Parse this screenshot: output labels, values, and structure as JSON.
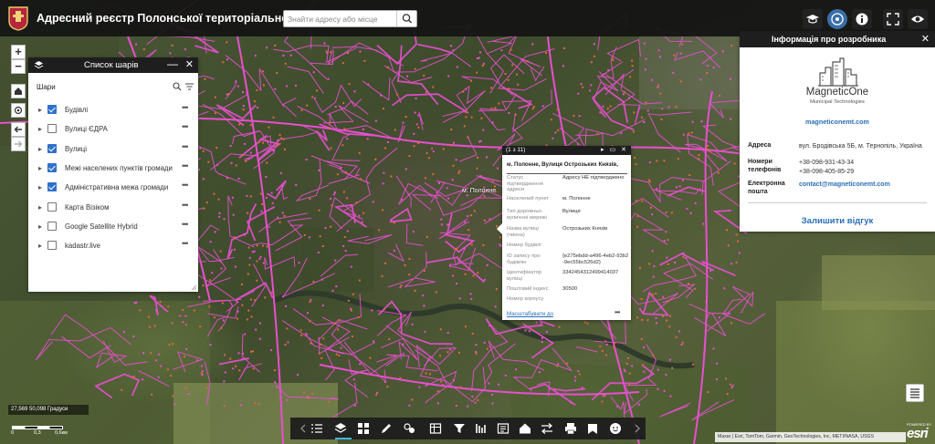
{
  "header": {
    "title": "Адресний реєстр Полонської територіальної громади",
    "search_placeholder": "Знайти адресу або місце"
  },
  "map": {
    "place_label": "м. Полонне",
    "line_color": "#e84fd0",
    "accent": "#2f72c9"
  },
  "zoom": {
    "in": "+",
    "out": "−"
  },
  "layer_list": {
    "title": "Список шарів",
    "section_label": "Шари",
    "minimize": "—",
    "close": "✕",
    "layers": [
      {
        "name": "Будівлі",
        "checked": true
      },
      {
        "name": "Вулиці ЄДРА",
        "checked": false
      },
      {
        "name": "Вулиці",
        "checked": true
      },
      {
        "name": "Межі населених пунктів громади",
        "checked": true
      },
      {
        "name": "Адміністративна межа громади",
        "checked": true
      },
      {
        "name": "Карта Візіком",
        "checked": false
      },
      {
        "name": "Google Satellite Hybrid",
        "checked": false
      },
      {
        "name": "kadastr.live",
        "checked": false
      }
    ],
    "more": "•••"
  },
  "popup": {
    "counter": "(1 з 11)",
    "controls": "▸ ▭ ✕",
    "title": "м. Полонне, Вулиця Острозьких Князів,",
    "fields": [
      {
        "key": "Статус підтвердження адреси",
        "value": "Адресу НЕ підтверджено"
      },
      {
        "key": "Населений пункт",
        "value": "м. Полонне"
      },
      {
        "key": "Тип дорожньо-вуличної мережі",
        "value": "Вулиця"
      },
      {
        "key": "Назва вулиці (чинна)",
        "value": "Острозьких Князів"
      },
      {
        "key": "Номер будівлі",
        "value": ""
      },
      {
        "key": "ID запису про будівлю",
        "value": "{e275ebdd-a496-4eb2-93b2-9ec55bc526d2}"
      },
      {
        "key": "Ідентифікатор вулиці",
        "value": "3342454312499414037"
      },
      {
        "key": "Поштовий індекс",
        "value": "30500"
      },
      {
        "key": "Номер корпусу",
        "value": ""
      }
    ],
    "zoom_link": "Масштабувати до",
    "more": "•••"
  },
  "developer": {
    "title": "Інформація про розробника",
    "close": "✕",
    "brand": "MagneticOne",
    "brand_sub": "Municipal Technologies",
    "website": "magneticonemt.com",
    "address_label": "Адреса",
    "address": "вул. Бродівська 5Б, м. Тернопіль, Україна",
    "phones_label": "Номери телефонів",
    "phones": "+38-098-931-43-34\n+38-098-405-85-29",
    "email_label": "Електронна пошта",
    "email": "contact@magneticonemt.com",
    "feedback": "Залишити відгук"
  },
  "coords": "27,569 50,098 Градуси",
  "scale": {
    "labels": [
      "0",
      "0,3",
      "0,6км"
    ]
  },
  "attribution": "Maxar | Esri, TomTom, Garmin, GeoTechnologies, Inc, METI/NASA, USGS",
  "esri": {
    "powered": "POWERED BY",
    "logo": "esri"
  },
  "toolbar_icons": [
    "prev-icon",
    "list-icon",
    "layers-icon",
    "basemap-gallery-icon",
    "draw-icon",
    "analysis-icon",
    "attribute-table-icon",
    "filter-icon",
    "query-icon",
    "edit-icon",
    "home-icon",
    "swipe-icon",
    "print-icon",
    "bookmark-icon",
    "about-icon",
    "next-icon"
  ]
}
